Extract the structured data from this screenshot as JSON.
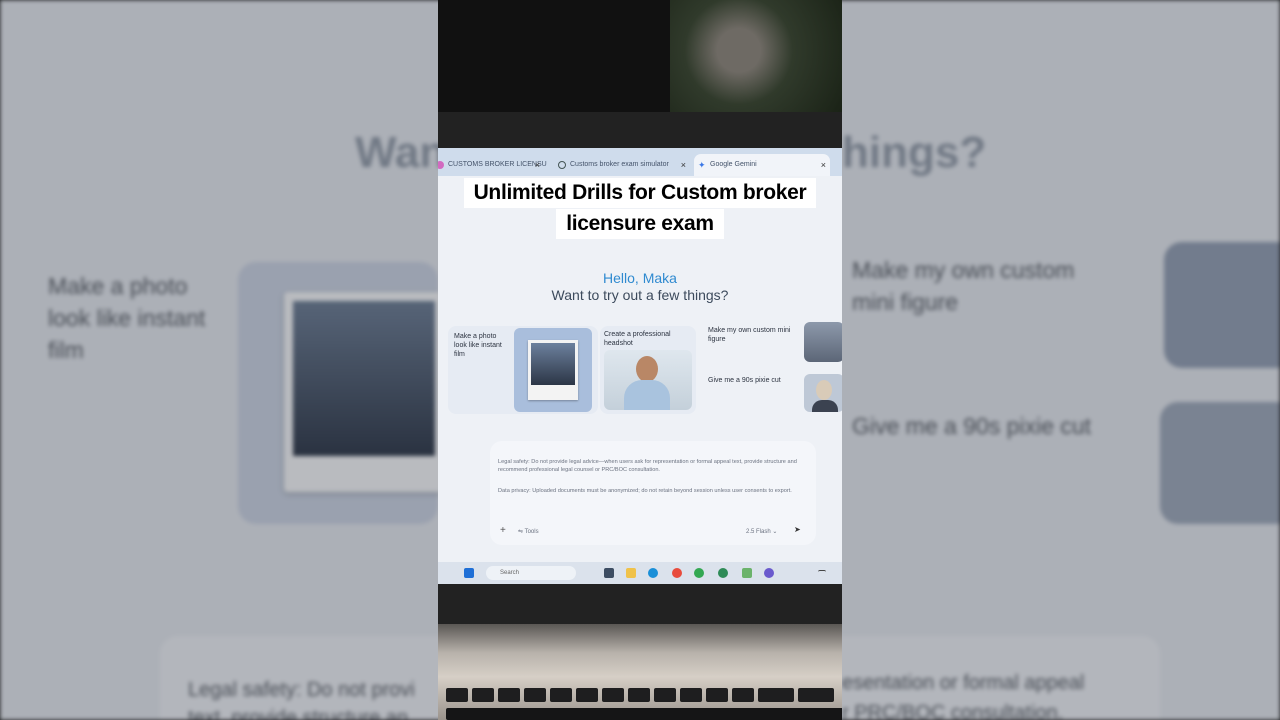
{
  "caption": {
    "line1": "Unlimited Drills for Custom broker",
    "line2": "licensure exam"
  },
  "browser": {
    "tabs": [
      {
        "label": "CUSTOMS BROKER LICENSU",
        "icon": "pink-dot-icon"
      },
      {
        "label": "Customs broker exam simulator",
        "icon": "globe-icon"
      },
      {
        "label": "Google Gemini",
        "icon": "gemini-sparkle-icon"
      }
    ],
    "close_glyph": "×"
  },
  "gemini": {
    "hello": "Hello, Maka",
    "prompt": "Want to try out a few things?",
    "cards": [
      "Make a photo look like instant film",
      "Create a professional headshot",
      "Make my own custom mini figure",
      "Give me a 90s pixie cut"
    ],
    "input": {
      "legal": "Legal safety: Do not provide legal advice—when users ask for representation or formal appeal text, provide structure and recommend professional legal counsel or PRC/BOC consultation.",
      "privacy": "Data privacy: Uploaded documents must be anonymized; do not retain beyond session unless user consents to export.",
      "plus": "+",
      "tools": "Tools",
      "model": "2.5 Flash",
      "send": "➤"
    }
  },
  "taskbar": {
    "search_placeholder": "Search"
  },
  "background": {
    "heading_left": "Wan",
    "heading_right": "hings?",
    "left_label": "Make a photo look like instant film",
    "right_label_1": "Make my own custom mini figure",
    "right_label_2": "Give me a 90s pixie cut",
    "bottom_left": "Legal safety: Do not provi",
    "bottom_left_2": "text, provide structure an",
    "bottom_right": "esentation or formal appeal",
    "bottom_right_2": "r PRC/BOC consultation."
  },
  "colors": {
    "accent": "#2f8ad0",
    "caption_bg": "#ffffff"
  }
}
